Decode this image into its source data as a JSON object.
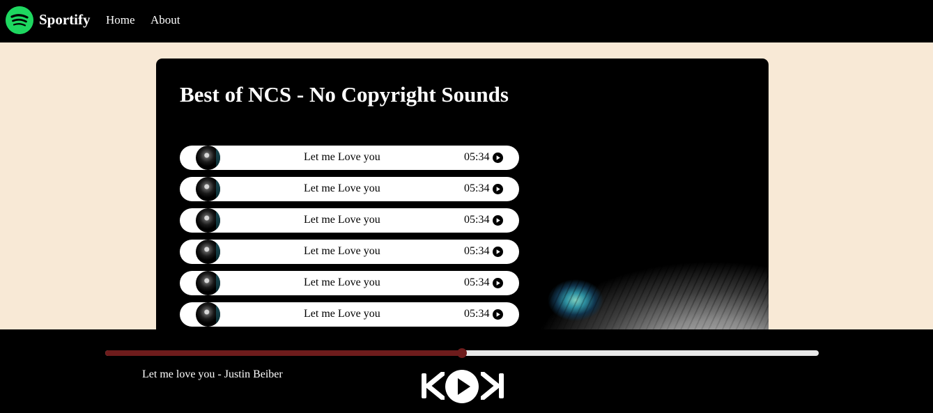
{
  "nav": {
    "brand": "Sportify",
    "links": [
      "Home",
      "About"
    ]
  },
  "playlist": {
    "title": "Best of NCS - No Copyright Sounds",
    "songs": [
      {
        "name": "Let me Love you",
        "duration": "05:34"
      },
      {
        "name": "Let me Love you",
        "duration": "05:34"
      },
      {
        "name": "Let me Love you",
        "duration": "05:34"
      },
      {
        "name": "Let me Love you",
        "duration": "05:34"
      },
      {
        "name": "Let me Love you",
        "duration": "05:34"
      },
      {
        "name": "Let me Love you",
        "duration": "05:34"
      }
    ]
  },
  "player": {
    "now_playing": "Let me love you - Justin Beiber",
    "progress_percent": 50,
    "controls": [
      "previous-icon",
      "play-icon",
      "next-icon"
    ]
  },
  "colors": {
    "background": "#f8e9d6",
    "nav": "#000000",
    "brand_accent": "#1ed760",
    "progress": "#6e1c1c"
  }
}
